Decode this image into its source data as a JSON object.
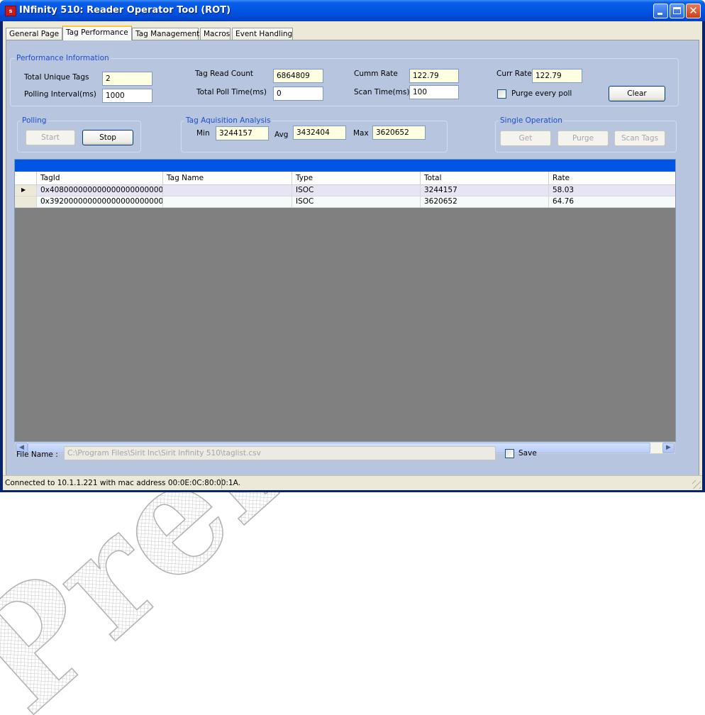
{
  "window": {
    "title": "INfinity 510: Reader Operator Tool (ROT)",
    "app_icon_text": "sirit"
  },
  "tabs": [
    {
      "label": "General Page",
      "active": false
    },
    {
      "label": "Tag Performance",
      "active": true
    },
    {
      "label": "Tag Management",
      "active": false
    },
    {
      "label": "Macros",
      "active": false
    },
    {
      "label": "Event Handling",
      "active": false
    }
  ],
  "performance_info": {
    "title": "Performance Information",
    "total_unique_tags_label": "Total Unique Tags",
    "total_unique_tags": "2",
    "polling_interval_label": "Polling Interval(ms)",
    "polling_interval": "1000",
    "tag_read_count_label": "Tag Read Count",
    "tag_read_count": "6864809",
    "total_poll_time_label": "Total Poll Time(ms)",
    "total_poll_time": "0",
    "cumm_rate_label": "Cumm Rate",
    "cumm_rate": "122.79",
    "scan_time_label": "Scan Time(ms)",
    "scan_time": "100",
    "curr_rate_label": "Curr Rate",
    "curr_rate": "122.79",
    "purge_every_poll_label": "Purge every poll",
    "clear_label": "Clear"
  },
  "polling": {
    "title": "Polling",
    "start_label": "Start",
    "stop_label": "Stop"
  },
  "analysis": {
    "title": "Tag Aquisition Analysis",
    "min_label": "Min",
    "min": "3244157",
    "avg_label": "Avg",
    "avg": "3432404",
    "max_label": "Max",
    "max": "3620652"
  },
  "single_operation": {
    "title": "Single Operation",
    "get_label": "Get",
    "purge_label": "Purge",
    "scan_tags_label": "Scan Tags"
  },
  "grid": {
    "columns": [
      "TagId",
      "Tag Name",
      "Type",
      "Total",
      "Rate"
    ],
    "rows": [
      {
        "tag_id": "0x408000000000000000000000",
        "tag_name": "",
        "type": "ISOC",
        "total": "3244157",
        "rate": "58.03"
      },
      {
        "tag_id": "0x392000000000000000000000",
        "tag_name": "",
        "type": "ISOC",
        "total": "3620652",
        "rate": "64.76"
      }
    ],
    "row_indicator": "▶"
  },
  "file": {
    "label": "File Name :",
    "path": "C:\\Program Files\\Sirit Inc\\Sirit Infinity 510\\taglist.csv",
    "save_label": "Save"
  },
  "status": {
    "text": "Connected to 10.1.1.221 with mac address 00:0E:0C:80:00:1A."
  },
  "watermark": {
    "text": "Prel"
  }
}
